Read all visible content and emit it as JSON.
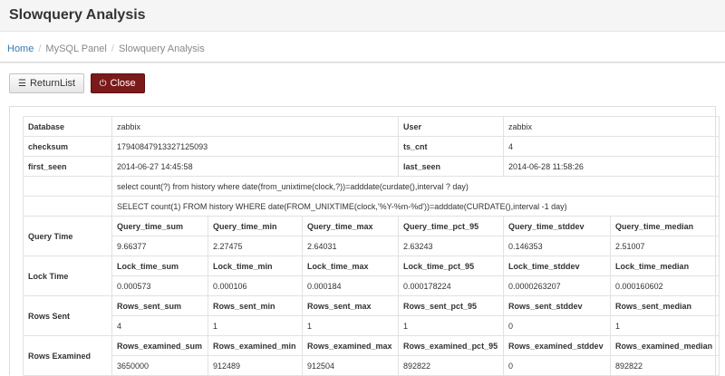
{
  "page": {
    "title": "Slowquery Analysis"
  },
  "breadcrumb": {
    "home": "Home",
    "panel": "MySQL Panel",
    "current": "Slowquery Analysis",
    "sep": "/"
  },
  "toolbar": {
    "return_label": "ReturnList",
    "close_label": "Close"
  },
  "summary": {
    "database_label": "Database",
    "database_value": "zabbix",
    "user_label": "User",
    "user_value": "zabbix",
    "checksum_label": "checksum",
    "checksum_value": "17940847913327125093",
    "ts_cnt_label": "ts_cnt",
    "ts_cnt_value": "4",
    "first_seen_label": "first_seen",
    "first_seen_value": "2014-06-27 14:45:58",
    "last_seen_label": "last_seen",
    "last_seen_value": "2014-06-28 11:58:26",
    "fingerprint": "select count(?) from history where date(from_unixtime(clock,?))=adddate(curdate(),interval ? day)",
    "sample": "SELECT count(1) FROM history WHERE date(FROM_UNIXTIME(clock,'%Y-%m-%d'))=adddate(CURDATE(),interval -1 day)"
  },
  "metrics": [
    {
      "label": "Query Time",
      "headers": [
        "Query_time_sum",
        "Query_time_min",
        "Query_time_max",
        "Query_time_pct_95",
        "Query_time_stddev",
        "Query_time_median"
      ],
      "values": [
        "9.66377",
        "2.27475",
        "2.64031",
        "2.63243",
        "0.146353",
        "2.51007"
      ]
    },
    {
      "label": "Lock Time",
      "headers": [
        "Lock_time_sum",
        "Lock_time_min",
        "Lock_time_max",
        "Lock_time_pct_95",
        "Lock_time_stddev",
        "Lock_time_median"
      ],
      "values": [
        "0.000573",
        "0.000106",
        "0.000184",
        "0.000178224",
        "0.0000263207",
        "0.000160602"
      ]
    },
    {
      "label": "Rows Sent",
      "headers": [
        "Rows_sent_sum",
        "Rows_sent_min",
        "Rows_sent_max",
        "Rows_sent_pct_95",
        "Rows_sent_stddev",
        "Rows_sent_median"
      ],
      "values": [
        "4",
        "1",
        "1",
        "1",
        "0",
        "1"
      ]
    },
    {
      "label": "Rows Examined",
      "headers": [
        "Rows_examined_sum",
        "Rows_examined_min",
        "Rows_examined_max",
        "Rows_examined_pct_95",
        "Rows_examined_stddev",
        "Rows_examined_median"
      ],
      "values": [
        "3650000",
        "912489",
        "912504",
        "892822",
        "0",
        "892822"
      ]
    }
  ]
}
